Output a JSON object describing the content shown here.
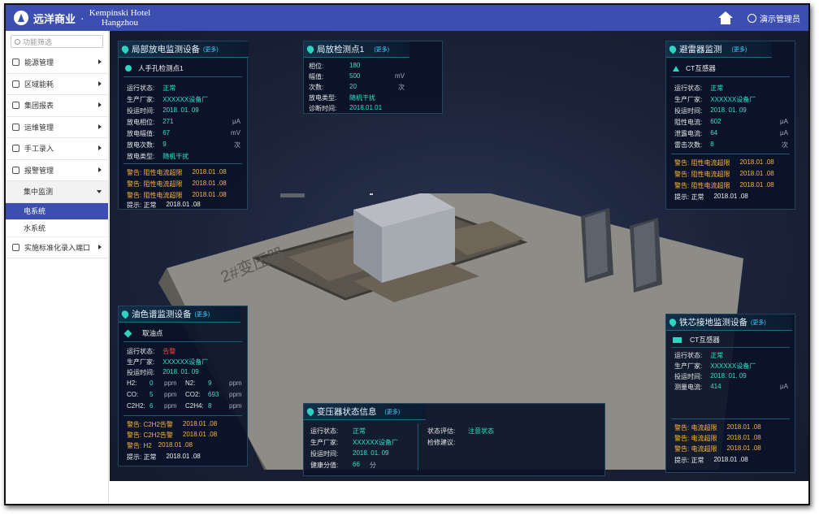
{
  "header": {
    "brand": "远洋商业",
    "dot": "·",
    "hotel_line1": "Kempinski Hotel",
    "hotel_line2": "Hangzhou",
    "user": "演示管理员"
  },
  "sidebar": {
    "search_placeholder": "功能筛选",
    "items": [
      {
        "label": "能源管理"
      },
      {
        "label": "区域能耗"
      },
      {
        "label": "集团报表"
      },
      {
        "label": "运维管理"
      },
      {
        "label": "手工录入"
      },
      {
        "label": "报警管理"
      }
    ],
    "open_item": "集中监测",
    "sub_items": [
      {
        "label": "电系统"
      },
      {
        "label": "水系统"
      }
    ],
    "last_item": "实施标准化录入端口"
  },
  "scene": {
    "transformer_label": "2#变压器"
  },
  "pd_panel": {
    "title": "局部放电监测设备",
    "more": "(更多)",
    "point": "人手孔检测点1",
    "status_lbl": "运行状态:",
    "status_val": "正常",
    "maker_lbl": "生产厂家:",
    "maker_val": "XXXXXX设备厂",
    "time_lbl": "投运时间:",
    "time_val": "2018. 01. 09",
    "phase_lbl": "放电相位:",
    "phase_val": "271",
    "phase_unit": "μA",
    "amp_lbl": "放电幅值:",
    "amp_val": "67",
    "amp_unit": "mV",
    "count_lbl": "放电次数:",
    "count_val": "9",
    "count_unit": "次",
    "type_lbl": "放电类型:",
    "type_val": "随机干扰",
    "alerts": [
      {
        "text": "警告: 阻性电流超限",
        "date": "2018.01 .08"
      },
      {
        "text": "警告: 阻性电流超限",
        "date": "2018.01 .08"
      },
      {
        "text": "警告: 阻性电流超限",
        "date": "2018.01 .08"
      }
    ],
    "tip_lbl": "提示: 正常",
    "tip_date": "2018.01 .08"
  },
  "point_panel": {
    "title": "局放检测点1",
    "more": "(更多)",
    "phase_lbl": "相位:",
    "phase_val": "180",
    "amp_lbl": "幅值:",
    "amp_val": "500",
    "amp_unit": "mV",
    "count_lbl": "次数:",
    "count_val": "20",
    "count_unit": "次",
    "type_lbl": "放电类型:",
    "type_val": "随机干扰",
    "diag_lbl": "诊断时间:",
    "diag_val": "2018.01.01"
  },
  "arrester_panel": {
    "title": "避雷器监测",
    "more": "(更多)",
    "sensor": "CT互感器",
    "status_lbl": "运行状态:",
    "status_val": "正常",
    "maker_lbl": "生产厂家:",
    "maker_val": "XXXXXX设备厂",
    "time_lbl": "投运时间:",
    "time_val": "2018. 01. 09",
    "res_lbl": "阻性电流:",
    "res_val": "602",
    "res_unit": "μA",
    "leak_lbl": "泄露电流:",
    "leak_val": "64",
    "leak_unit": "μA",
    "strike_lbl": "雷击次数:",
    "strike_val": "8",
    "strike_unit": "次",
    "alerts": [
      {
        "text": "警告: 阻性电流超限",
        "date": "2018.01 .08"
      },
      {
        "text": "警告: 阻性电流超限",
        "date": "2018.01 .08"
      },
      {
        "text": "警告: 阻性电流超限",
        "date": "2018.01 .08"
      }
    ],
    "tip_lbl": "提示: 正常",
    "tip_date": "2018.01 .08"
  },
  "oil_panel": {
    "title": "油色谱监测设备",
    "more": "(更多)",
    "point": "取油点",
    "status_lbl": "运行状态:",
    "status_val": "告警",
    "maker_lbl": "生产厂家:",
    "maker_val": "XXXXXX设备厂",
    "time_lbl": "投运时间:",
    "time_val": "2018. 01. 09",
    "gases": [
      {
        "n1": "H2:",
        "v1": "0",
        "u1": "ppm",
        "n2": "N2:",
        "v2": "9",
        "u2": "ppm"
      },
      {
        "n1": "CO:",
        "v1": "5",
        "u1": "ppm",
        "n2": "CO2:",
        "v2": "693",
        "u2": "ppm"
      },
      {
        "n1": "C2H2:",
        "v1": "6",
        "u1": "ppm",
        "n2": "C2H4:",
        "v2": "8",
        "u2": "ppm"
      }
    ],
    "alerts": [
      {
        "text": "警告: C2H2告警",
        "date": "2018.01 .08"
      },
      {
        "text": "警告: C2H2告警",
        "date": "2018.01 .08"
      },
      {
        "text": "警告: H2",
        "date": "2018.01 .08"
      }
    ],
    "tip_lbl": "提示: 正常",
    "tip_date": "2018.01 .08"
  },
  "transformer_panel": {
    "title": "变压器状态信息",
    "more": "(更多)",
    "status_lbl": "运行状态:",
    "status_val": "正常",
    "maker_lbl": "生产厂家:",
    "maker_val": "XXXXXX设备厂",
    "time_lbl": "投运时间:",
    "time_val": "2018. 01. 09",
    "health_lbl": "健康分值:",
    "health_val": "66",
    "health_unit": "分",
    "eval_lbl": "状态评估:",
    "eval_val": "注意状态",
    "advice_lbl": "检修建议:"
  },
  "core_panel": {
    "title": "铁芯接地监测设备",
    "more": "(更多)",
    "sensor": "CT互感器",
    "status_lbl": "运行状态:",
    "status_val": "正常",
    "maker_lbl": "生产厂家:",
    "maker_val": "XXXXXX设备厂",
    "time_lbl": "投运时间:",
    "time_val": "2018. 01. 09",
    "cur_lbl": "测量电流:",
    "cur_val": "414",
    "cur_unit": "μA",
    "alerts": [
      {
        "text": "警告: 电流超限",
        "date": "2018.01 .08"
      },
      {
        "text": "警告: 电流超限",
        "date": "2018.01 .08"
      },
      {
        "text": "警告: 电流超限",
        "date": "2018.01 .08"
      }
    ],
    "tip_lbl": "提示: 正常",
    "tip_date": "2018.01 .08"
  }
}
